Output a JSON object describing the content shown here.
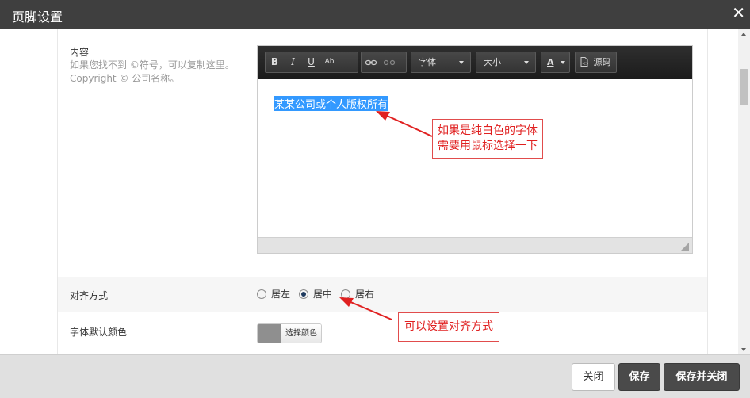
{
  "dialog": {
    "title": "页脚设置"
  },
  "content_field": {
    "label": "内容",
    "help": "如果您找不到 ©符号，可以复制这里。Copyright © 公司名称。"
  },
  "editor": {
    "toolbar": {
      "bold": "B",
      "italic": "I",
      "underline": "U",
      "strike": "Ab",
      "font_label": "字体",
      "size_label": "大小",
      "color_label": "A",
      "source_label": "源码"
    },
    "selected_text": "某某公司或个人版权所有"
  },
  "annotations": {
    "editor_note_line1": "如果是纯白色的字体",
    "editor_note_line2": "需要用鼠标选择一下",
    "align_note": "可以设置对齐方式"
  },
  "align_field": {
    "label": "对齐方式",
    "options": [
      "居左",
      "居中",
      "居右"
    ],
    "selected": "居中"
  },
  "color_field": {
    "label": "字体默认颜色",
    "button_label": "选择颜色",
    "swatch_color": "#8f8f8f"
  },
  "footer": {
    "close_label": "关闭",
    "save_label": "保存",
    "save_close_label": "保存并关闭"
  },
  "colors": {
    "accent_red": "#e02020",
    "selection_blue": "#3399ff",
    "titlebar": "#3f3f3f"
  }
}
